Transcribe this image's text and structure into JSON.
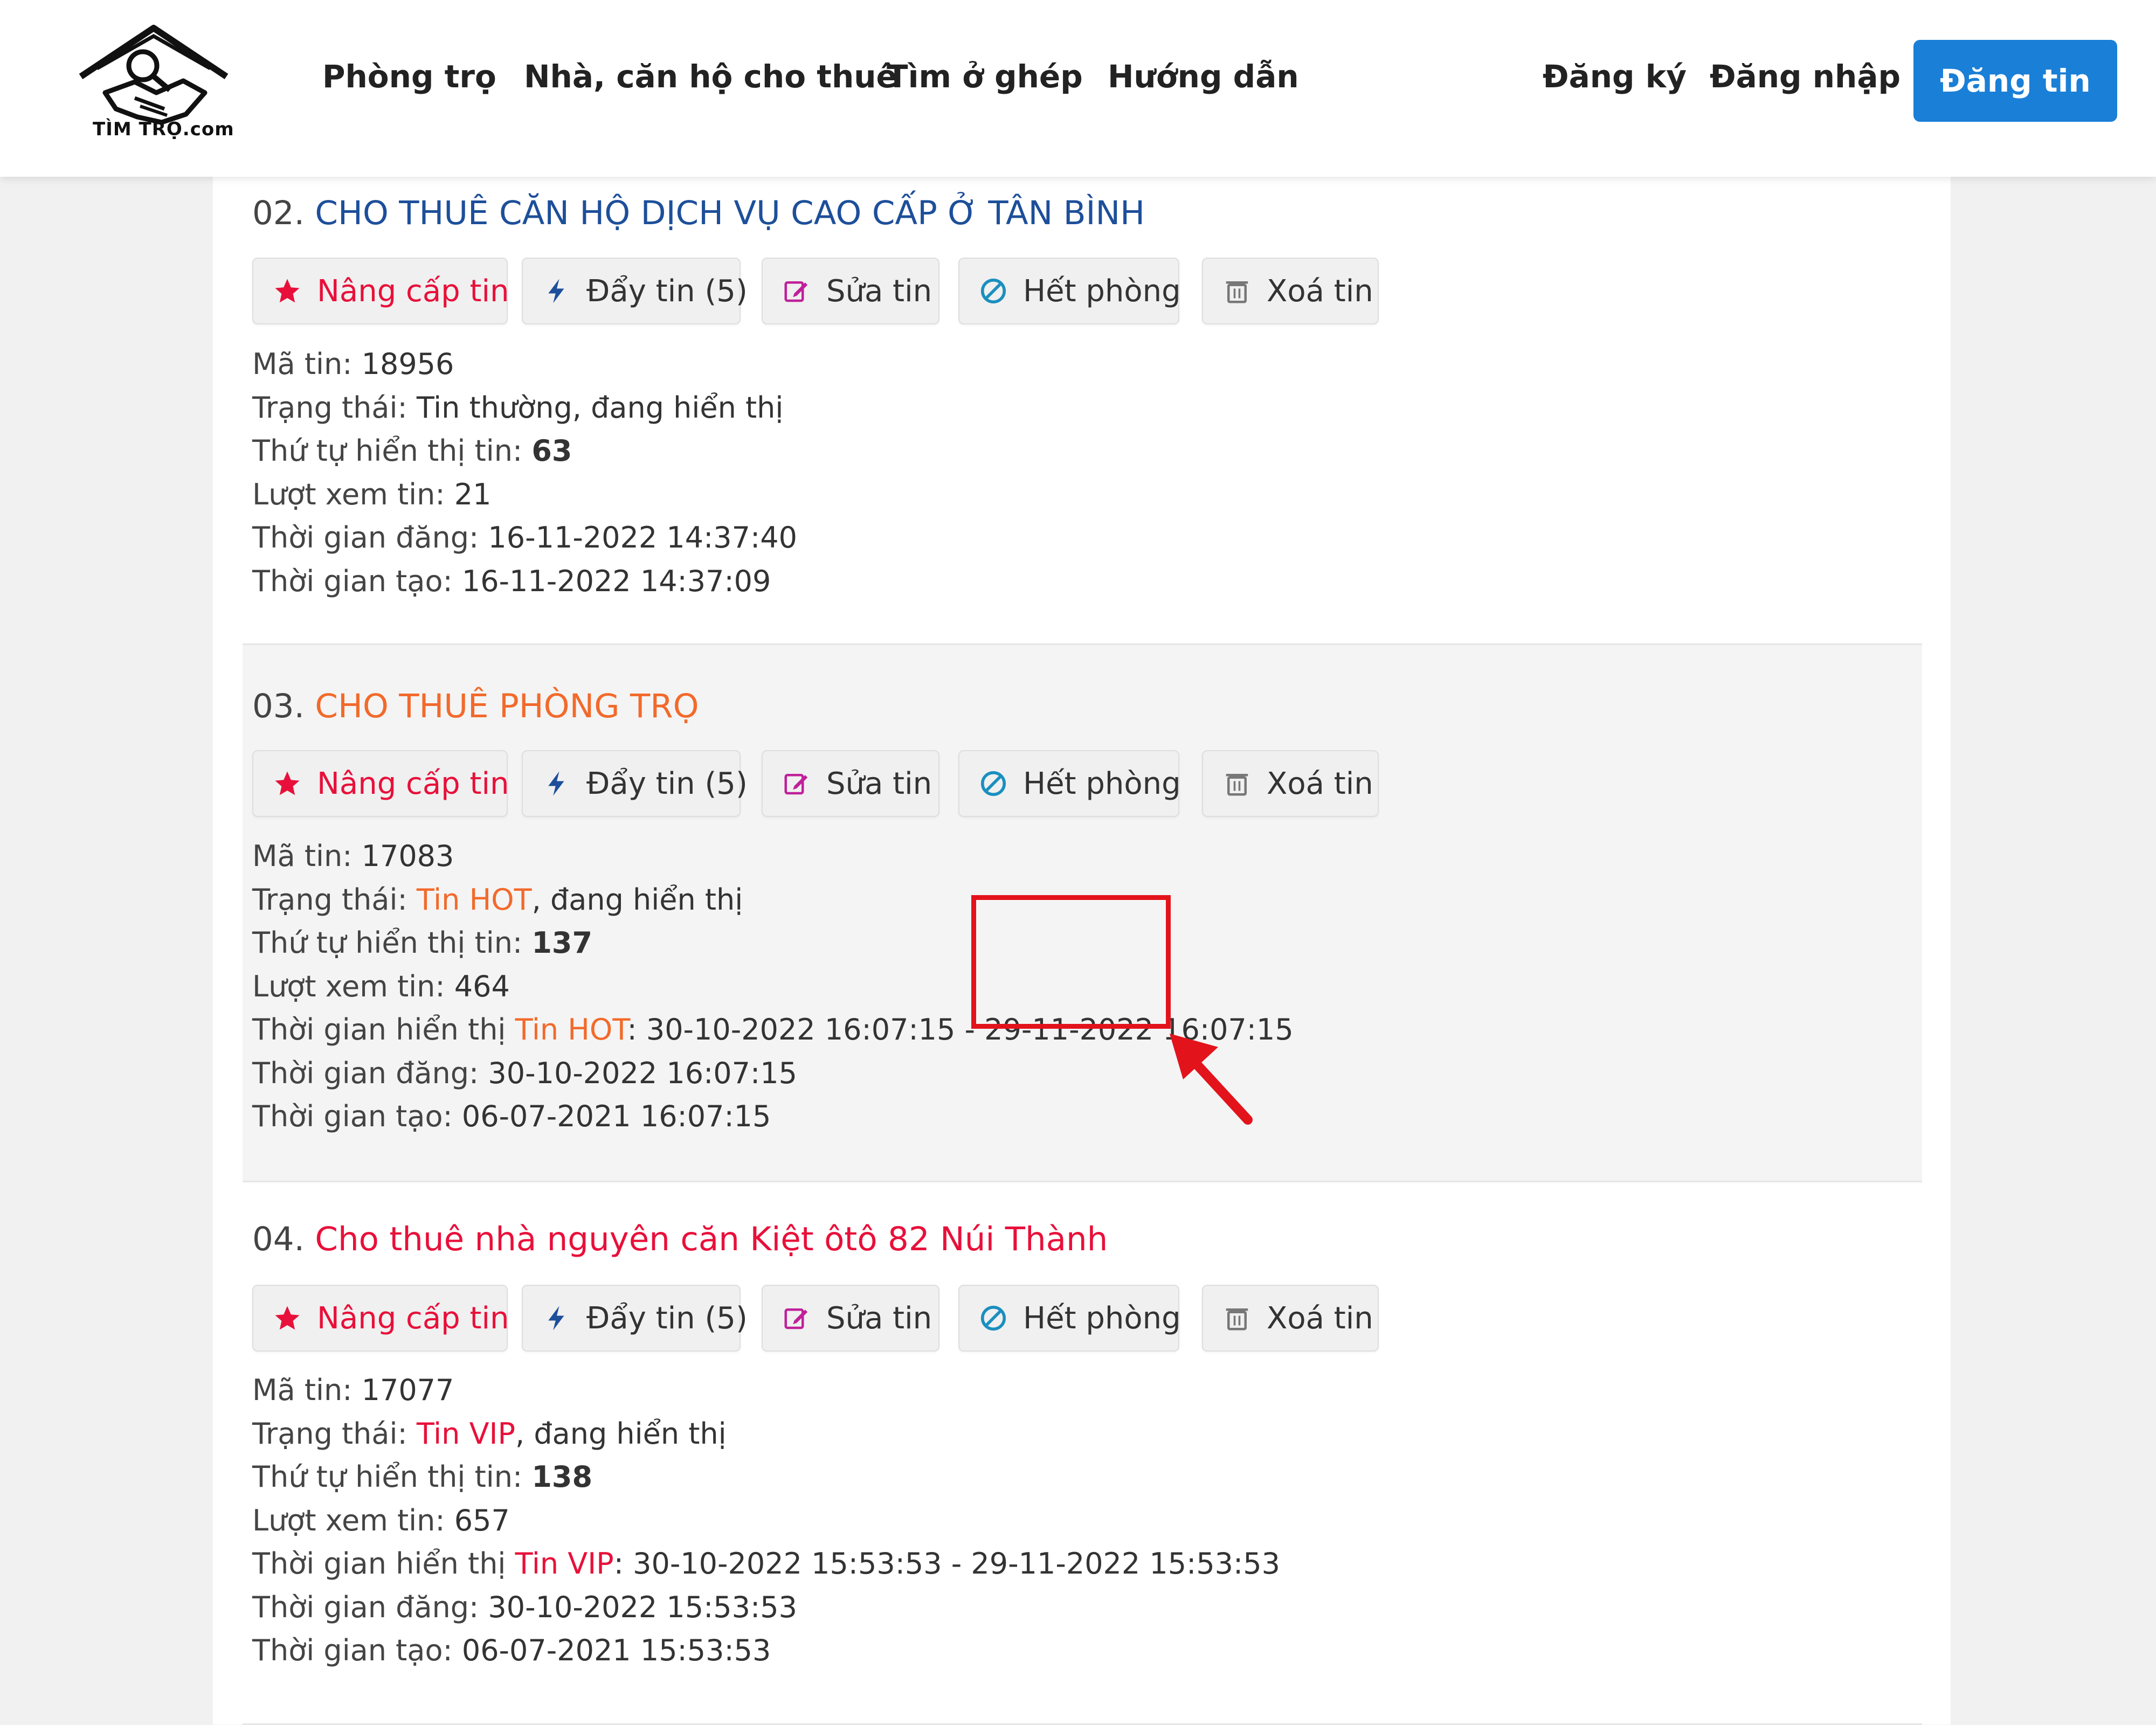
{
  "header": {
    "logo_text": "TÌM TRỌ.com",
    "nav": [
      "Phòng trọ",
      "Nhà, căn hộ cho thuê",
      "Tìm ở ghép",
      "Hướng dẫn"
    ],
    "register": "Đăng ký",
    "login": "Đăng nhập",
    "post_button": "Đăng tin"
  },
  "labels": {
    "upgrade": "Nâng cấp tin",
    "push": "Đẩy tin (5)",
    "edit": "Sửa tin",
    "soldout": "Hết phòng",
    "delete": "Xoá tin",
    "code": "Mã tin: ",
    "status": "Trạng thái: ",
    "order": "Thứ tự hiển thị tin: ",
    "views": "Lượt xem tin: ",
    "display_time": "Thời gian hiển thị ",
    "posted": "Thời gian đăng: ",
    "created": "Thời gian tạo: "
  },
  "listings": [
    {
      "number": "02.",
      "title": "CHO THUÊ CĂN HỘ DỊCH VỤ CAO CẤP Ở TÂN BÌNH",
      "title_color": "#1d4f9a",
      "code": "18956",
      "status_tier": "Tin thường",
      "status_suffix": ", đang hiển thị",
      "order": "63",
      "views": "21",
      "posted": "16-11-2022 14:37:40",
      "created": "16-11-2022 14:37:09"
    },
    {
      "number": "03.",
      "title": "CHO THUÊ PHÒNG TRỌ",
      "title_color": "#f26a2b",
      "code": "17083",
      "status_tier": "Tin HOT",
      "status_suffix": ", đang hiển thị",
      "order": "137",
      "views": "464",
      "display_tier": "Tin HOT",
      "display_range": ": 30-10-2022 16:07:15 - 29-11-2022 16:07:15",
      "posted": "30-10-2022 16:07:15",
      "created": "06-07-2021 16:07:15"
    },
    {
      "number": "04.",
      "title": "Cho thuê nhà nguyên căn Kiệt ôtô 82 Núi Thành",
      "title_color": "#e8103a",
      "code": "17077",
      "status_tier": "Tin VIP",
      "status_suffix": ", đang hiển thị",
      "order": "138",
      "views": "657",
      "display_tier": "Tin VIP",
      "display_range": ": 30-10-2022 15:53:53 - 29-11-2022 15:53:53",
      "posted": "30-10-2022 15:53:53",
      "created": "06-07-2021 15:53:53"
    }
  ],
  "colors": {
    "accent_blue": "#1a7fd7",
    "hot": "#f26a2b",
    "vip": "#e8103a",
    "highlight": "#e3131b"
  }
}
